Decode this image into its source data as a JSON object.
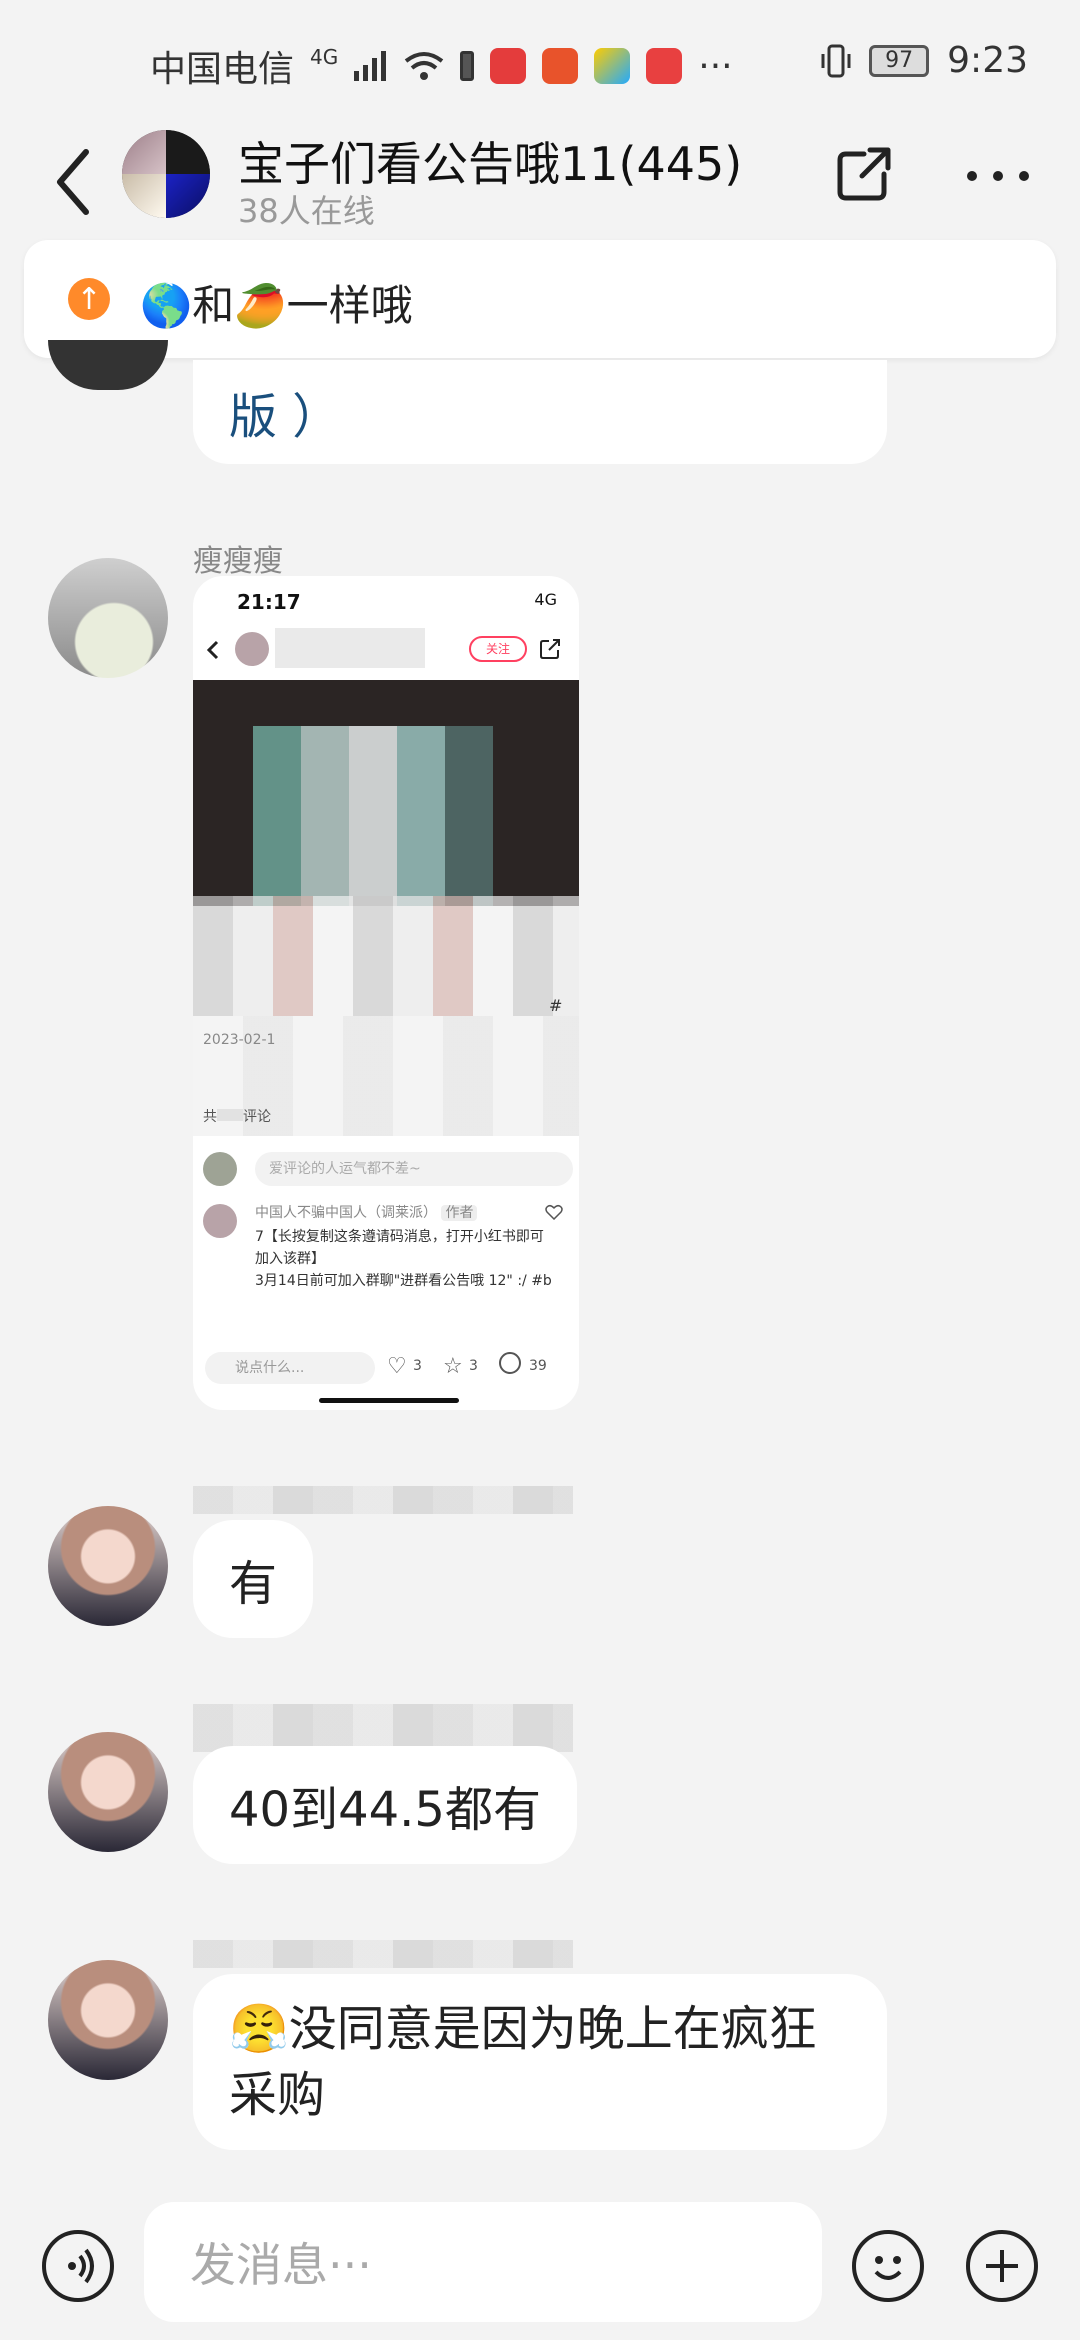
{
  "status_bar": {
    "carrier": "中国电信",
    "network": "4G",
    "battery": "97",
    "time": "9:23"
  },
  "header": {
    "title": "宝子们看公告哦11(445)",
    "online": "38人在线"
  },
  "announcement": {
    "text": "🌎和🥭一样哦"
  },
  "messages": [
    {
      "type": "text",
      "text": "版 ）"
    },
    {
      "type": "image",
      "sender": "瘦瘦瘦"
    },
    {
      "type": "text",
      "text": "有"
    },
    {
      "type": "text",
      "text": "40到44.5都有"
    },
    {
      "type": "text",
      "emoji": "😤",
      "text": "没同意是因为晚上在疯狂采购"
    }
  ],
  "shared_screenshot": {
    "time": "21:17",
    "net": "4G",
    "follow": "关注",
    "date": "2023-02-1",
    "comments_prefix": "共",
    "comments_suffix": "评论",
    "comment_placeholder": "爱评论的人运气都不差~",
    "commenter": "中国人不骗中国人（调莱派）",
    "author_tag": "作者",
    "comment_line1": "7【长按复制这条遵请码消息，打开小红书即可加入该群】",
    "comment_line2": "3月14日前可加入群聊\"进群看公告哦 12\" :/ #b",
    "reply_placeholder": "说点什么...",
    "likes": "3",
    "stars": "3",
    "comments": "39",
    "hashtag": "#"
  },
  "input": {
    "placeholder": "发消息···"
  }
}
